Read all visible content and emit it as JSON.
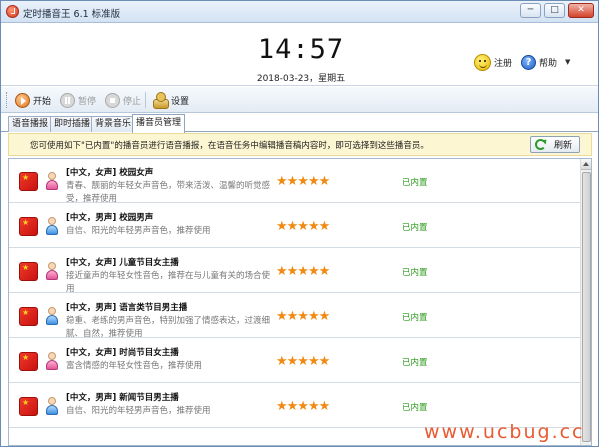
{
  "window": {
    "title": "定时播音王 6.1 标准版",
    "minimize_label": "─",
    "maximize_label": "□",
    "close_label": "✕"
  },
  "clock": {
    "time": "14:57",
    "date": "2018-03-23，星期五"
  },
  "header": {
    "register_label": "注册",
    "help_label": "帮助",
    "help_menu_arrow": "▼"
  },
  "toolbar": {
    "start_label": "开始",
    "pause_label": "暂停",
    "stop_label": "停止",
    "settings_label": "设置"
  },
  "tabs": [
    {
      "label": "语音播报",
      "active": false
    },
    {
      "label": "即时插播",
      "active": false
    },
    {
      "label": "背景音乐",
      "active": false
    },
    {
      "label": "播音员管理",
      "active": true
    }
  ],
  "notice": {
    "text": "您可使用如下\"已内置\"的播音员进行语音播报，在语音任务中编辑播音稿内容时，即可选择到这些播音员。",
    "refresh_label": "刷新"
  },
  "voices": [
    {
      "name": "[中文，女声] 校园女声",
      "gender": "female",
      "desc": "青春、靓丽的年轻女声音色，带来活泼、温馨的听觉感受，推荐使用",
      "rating": 5,
      "stars": "★★★★★",
      "status": "已内置"
    },
    {
      "name": "[中文，男声] 校园男声",
      "gender": "male",
      "desc": "自信、阳光的年轻男声音色，推荐使用",
      "rating": 5,
      "stars": "★★★★★",
      "status": "已内置"
    },
    {
      "name": "[中文，女声] 儿童节目女主播",
      "gender": "female",
      "desc": "接近童声的年轻女性音色，推荐在与儿童有关的场合使用",
      "rating": 5,
      "stars": "★★★★★",
      "status": "已内置"
    },
    {
      "name": "[中文，男声] 语言类节目男主播",
      "gender": "male",
      "desc": "稳重、老练的男声音色，特别加强了情感表达，过渡细腻、自然，推荐使用",
      "rating": 5,
      "stars": "★★★★★",
      "status": "已内置"
    },
    {
      "name": "[中文，女声] 时尚节目女主播",
      "gender": "female",
      "desc": "富含情感的年轻女性音色，推荐使用",
      "rating": 5,
      "stars": "★★★★★",
      "status": "已内置"
    },
    {
      "name": "[中文，男声] 新闻节目男主播",
      "gender": "male",
      "desc": "自信、阳光的年轻男声音色，推荐使用",
      "rating": 5,
      "stars": "★★★★★",
      "status": "已内置"
    }
  ],
  "watermark": "www.ucbug.cc",
  "colors": {
    "accent": "#2a9a1a",
    "star": "#f08a12",
    "notice_bg": "#fcf6d2",
    "flag": "#d9251d"
  }
}
